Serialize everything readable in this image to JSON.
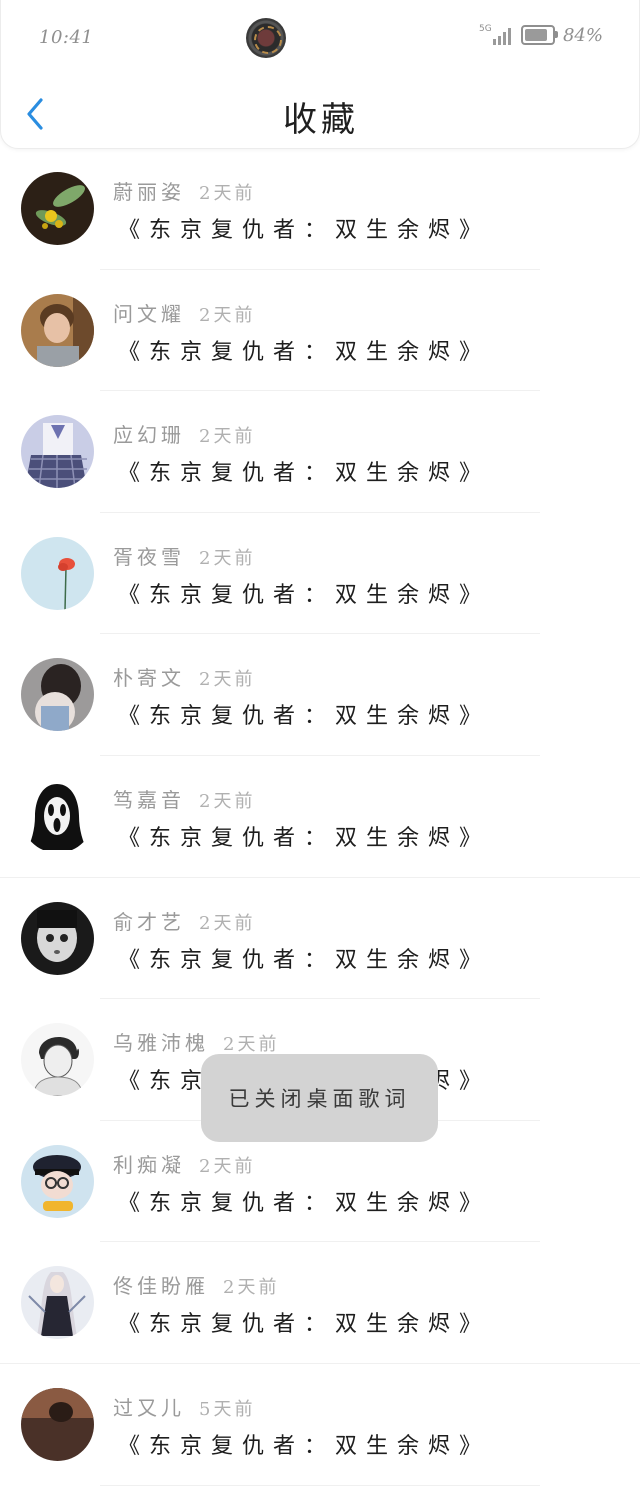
{
  "status_bar": {
    "time": "10:41",
    "network": "5G",
    "battery": "84%",
    "battery_fraction": 0.84
  },
  "header": {
    "title": "收藏"
  },
  "favorites": [
    {
      "user": "蔚丽姿",
      "time": "2天前",
      "song": "《东京复仇者：双生余烬》",
      "avatar": "avatar-plant"
    },
    {
      "user": "问文耀",
      "time": "2天前",
      "song": "《东京复仇者：双生余烬》",
      "avatar": "avatar-boy"
    },
    {
      "user": "应幻珊",
      "time": "2天前",
      "song": "《东京复仇者：双生余烬》",
      "avatar": "avatar-uniform"
    },
    {
      "user": "胥夜雪",
      "time": "2天前",
      "song": "《东京复仇者：双生余烬》",
      "avatar": "avatar-flower"
    },
    {
      "user": "朴寄文",
      "time": "2天前",
      "song": "《东京复仇者：双生余烬》",
      "avatar": "avatar-girl"
    },
    {
      "user": "笃嘉音",
      "time": "2天前",
      "song": "《东京复仇者：双生余烬》",
      "avatar": "avatar-ghostface"
    },
    {
      "user": "俞才艺",
      "time": "2天前",
      "song": "《东京复仇者：双生余烬》",
      "avatar": "avatar-doll"
    },
    {
      "user": "乌雅沛槐",
      "time": "2天前",
      "song": "《东京复仇者：双生余烬》",
      "avatar": "avatar-sketch"
    },
    {
      "user": "利痴凝",
      "time": "2天前",
      "song": "《东京复仇者：双生余烬》",
      "avatar": "avatar-cap"
    },
    {
      "user": "佟佳盼雁",
      "time": "2天前",
      "song": "《东京复仇者：双生余烬》",
      "avatar": "avatar-anime"
    },
    {
      "user": "过又儿",
      "time": "5天前",
      "song": "《东京复仇者：双生余烬》",
      "avatar": "avatar-room"
    }
  ],
  "toast": {
    "text": "已关闭桌面歌词"
  }
}
